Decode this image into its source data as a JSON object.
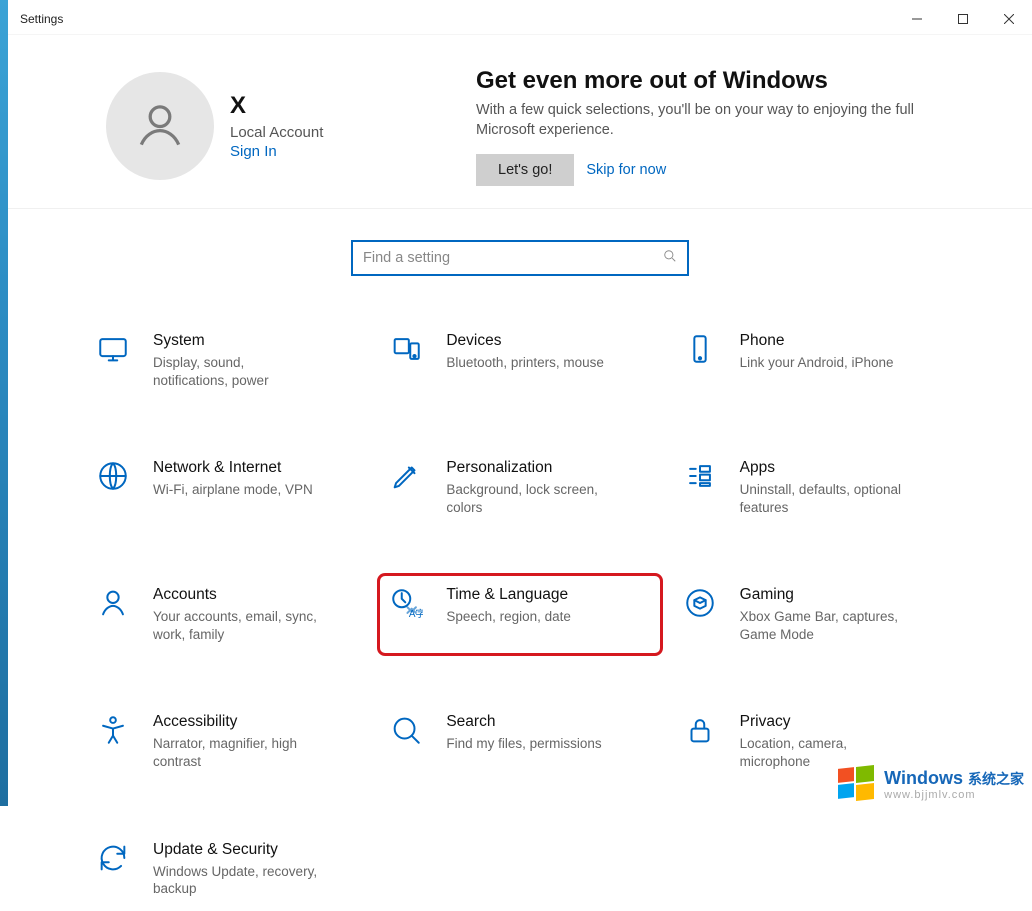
{
  "window_title": "Settings",
  "user": {
    "name": "X",
    "type": "Local Account",
    "signin": "Sign In"
  },
  "promo": {
    "heading": "Get even more out of Windows",
    "body": "With a few quick selections, you'll be on your way to enjoying the full Microsoft experience.",
    "lets_go": "Let's go!",
    "skip": "Skip for now"
  },
  "search": {
    "placeholder": "Find a setting"
  },
  "categories": [
    {
      "id": "system",
      "title": "System",
      "desc": "Display, sound, notifications, power"
    },
    {
      "id": "devices",
      "title": "Devices",
      "desc": "Bluetooth, printers, mouse"
    },
    {
      "id": "phone",
      "title": "Phone",
      "desc": "Link your Android, iPhone"
    },
    {
      "id": "network",
      "title": "Network & Internet",
      "desc": "Wi-Fi, airplane mode, VPN"
    },
    {
      "id": "personalization",
      "title": "Personalization",
      "desc": "Background, lock screen, colors"
    },
    {
      "id": "apps",
      "title": "Apps",
      "desc": "Uninstall, defaults, optional features"
    },
    {
      "id": "accounts",
      "title": "Accounts",
      "desc": "Your accounts, email, sync, work, family"
    },
    {
      "id": "time",
      "title": "Time & Language",
      "desc": "Speech, region, date",
      "highlight": true
    },
    {
      "id": "gaming",
      "title": "Gaming",
      "desc": "Xbox Game Bar, captures, Game Mode"
    },
    {
      "id": "accessibility",
      "title": "Accessibility",
      "desc": "Narrator, magnifier, high contrast"
    },
    {
      "id": "search",
      "title": "Search",
      "desc": "Find my files, permissions"
    },
    {
      "id": "privacy",
      "title": "Privacy",
      "desc": "Location, camera, microphone"
    },
    {
      "id": "update",
      "title": "Update & Security",
      "desc": "Windows Update, recovery, backup"
    }
  ],
  "watermark": {
    "brand": "Windows",
    "brand_cn": "系统之家",
    "url": "www.bjjmlv.com"
  }
}
